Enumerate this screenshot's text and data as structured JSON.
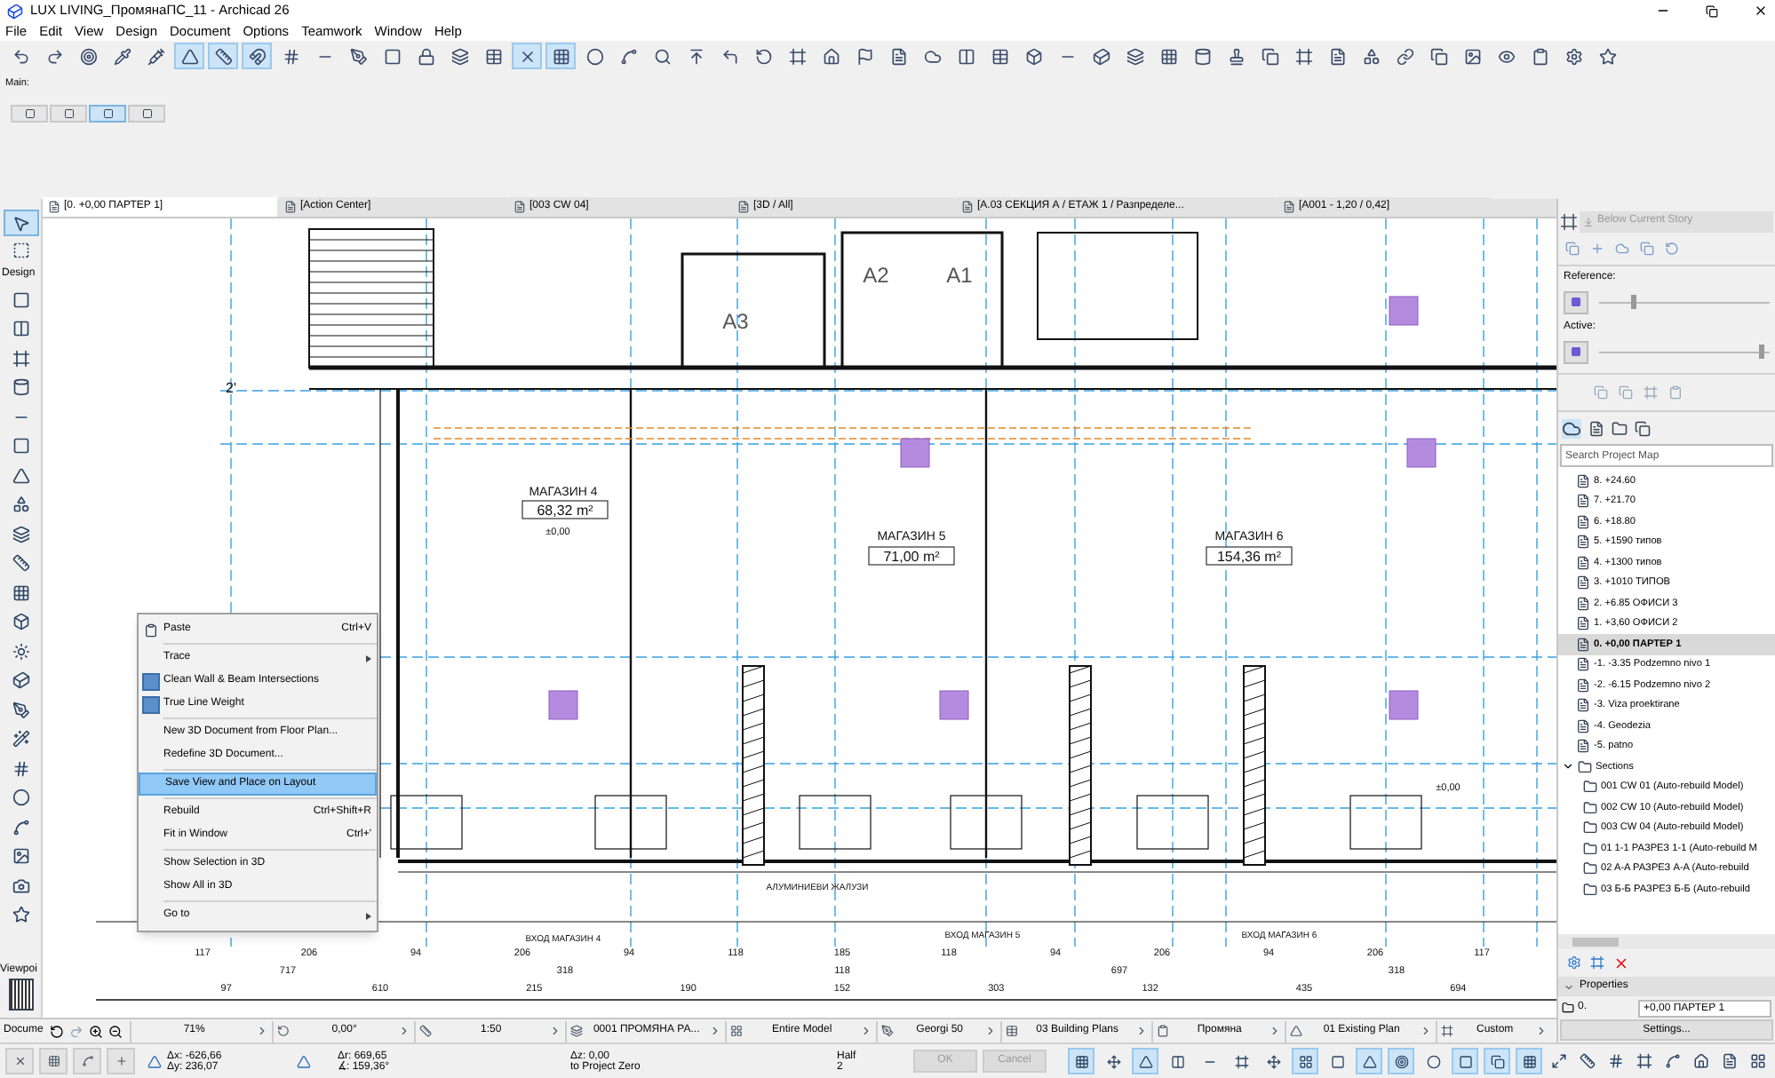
{
  "window": {
    "title": "LUX LIVING_ПромянаПС_11 - Archicad 26"
  },
  "menu": [
    "File",
    "Edit",
    "View",
    "Design",
    "Document",
    "Options",
    "Teamwork",
    "Window",
    "Help"
  ],
  "toolbar": {
    "buttons": [
      {
        "on": false
      },
      {
        "on": false
      },
      {
        "on": false
      },
      {
        "on": false
      },
      {
        "on": false
      },
      {
        "on": true
      },
      {
        "on": true
      },
      {
        "on": true
      },
      {
        "on": false
      },
      {
        "on": false
      },
      {
        "on": false
      },
      {
        "on": false
      },
      {
        "on": false
      },
      {
        "on": false
      },
      {
        "on": false
      },
      {
        "on": true
      },
      {
        "on": true
      },
      {
        "on": false
      },
      {
        "on": false
      },
      {
        "on": false
      },
      {
        "on": false
      },
      {
        "on": false
      },
      {
        "on": false
      },
      {
        "on": false
      },
      {
        "on": false
      },
      {
        "on": false
      },
      {
        "on": false
      },
      {
        "on": false
      },
      {
        "on": false
      },
      {
        "on": false
      },
      {
        "on": false
      },
      {
        "on": false
      },
      {
        "on": false
      },
      {
        "on": false
      },
      {
        "on": false
      },
      {
        "on": false
      },
      {
        "on": false
      },
      {
        "on": false
      },
      {
        "on": false
      },
      {
        "on": false
      },
      {
        "on": false
      },
      {
        "on": false
      },
      {
        "on": false
      },
      {
        "on": false
      },
      {
        "on": false
      },
      {
        "on": false
      },
      {
        "on": false
      },
      {
        "on": false
      }
    ]
  },
  "main_palette": {
    "label": "Main:",
    "buttons": [
      {
        "on": false
      },
      {
        "on": false
      },
      {
        "on": true
      },
      {
        "on": false
      }
    ]
  },
  "tabs": [
    {
      "label": "[0. +0,00 ПАРТЕР 1]",
      "selected": true
    },
    {
      "label": "[Action Center]",
      "selected": false
    },
    {
      "label": "[003 CW 04]",
      "selected": false
    },
    {
      "label": "[3D / All]",
      "selected": false
    },
    {
      "label": "[A.03 СЕКЦИЯ А / ЕТАЖ 1 / Разпределе...",
      "selected": false
    },
    {
      "label": "[A001 - 1,20 / 0,42]",
      "selected": false
    }
  ],
  "toolbox": {
    "title": "Design",
    "bottom_label": "Viewpoi",
    "tools": [
      {
        "selected": true
      },
      {
        "selected": false
      },
      {
        "selected": false
      },
      {
        "selected": false
      },
      {
        "selected": false
      },
      {
        "selected": false
      },
      {
        "selected": false
      },
      {
        "selected": false
      },
      {
        "selected": false
      },
      {
        "selected": false
      },
      {
        "selected": false
      },
      {
        "selected": false
      },
      {
        "selected": false
      },
      {
        "selected": false
      },
      {
        "selected": false
      },
      {
        "selected": false
      },
      {
        "selected": false
      },
      {
        "selected": false
      },
      {
        "selected": false
      },
      {
        "selected": false
      },
      {
        "selected": false
      },
      {
        "selected": false
      },
      {
        "selected": false
      },
      {
        "selected": false
      }
    ]
  },
  "drawing": {
    "labels": [
      {
        "text": "2'",
        "kind": "grid"
      },
      {
        "text": "A3",
        "kind": "tag"
      },
      {
        "text": "A2",
        "kind": "tag"
      },
      {
        "text": "A1",
        "kind": "tag"
      },
      {
        "text": "МАГАЗИН 4",
        "kind": "room"
      },
      {
        "text": "68,32 m²",
        "kind": "area"
      },
      {
        "text": "±0,00",
        "kind": "level"
      },
      {
        "text": "МАГАЗИН 5",
        "kind": "room"
      },
      {
        "text": "71,00 m²",
        "kind": "area"
      },
      {
        "text": "МАГАЗИН 6",
        "kind": "room"
      },
      {
        "text": "154,36 m²",
        "kind": "area"
      },
      {
        "text": "±0,00",
        "kind": "level"
      },
      {
        "text": "АЛУМИНИЕВИ ЖАЛУЗИ",
        "kind": "note"
      },
      {
        "text": "ВХОД МАГАЗИН 4",
        "kind": "note"
      },
      {
        "text": "ВХОД МАГАЗИН 5",
        "kind": "note"
      },
      {
        "text": "ВХОД МАГАЗИН 6",
        "kind": "note"
      }
    ],
    "dimension_rows": [
      [
        "117",
        "206",
        "94",
        "206",
        "94",
        "118",
        "185",
        "118",
        "94",
        "206",
        "94",
        "206",
        "117"
      ],
      [
        "717",
        "318",
        "118",
        "697",
        "318"
      ],
      [
        "97",
        "610",
        "215",
        "190",
        "152",
        "303",
        "132",
        "435",
        "694"
      ]
    ]
  },
  "context_menu": {
    "items": [
      {
        "kind": "item",
        "label": "Paste",
        "shortcut": "Ctrl+V",
        "submenu": false,
        "selected": false
      },
      {
        "kind": "separator"
      },
      {
        "kind": "item",
        "label": "Trace",
        "submenu": true,
        "selected": false
      },
      {
        "kind": "toggle",
        "label": "Clean Wall & Beam Intersections",
        "checked": true,
        "selected": false
      },
      {
        "kind": "toggle",
        "label": "True Line Weight",
        "checked": true,
        "selected": false
      },
      {
        "kind": "separator"
      },
      {
        "kind": "item",
        "label": "New 3D Document from Floor Plan...",
        "submenu": false,
        "selected": false
      },
      {
        "kind": "item",
        "label": "Redefine 3D Document...",
        "submenu": false,
        "selected": false
      },
      {
        "kind": "separator"
      },
      {
        "kind": "item",
        "label": "Save View and Place on Layout",
        "submenu": false,
        "selected": true
      },
      {
        "kind": "separator"
      },
      {
        "kind": "item",
        "label": "Rebuild",
        "shortcut": "Ctrl+Shift+R",
        "submenu": false,
        "selected": false
      },
      {
        "kind": "item",
        "label": "Fit in Window",
        "shortcut": "Ctrl+'",
        "submenu": false,
        "selected": false
      },
      {
        "kind": "separator"
      },
      {
        "kind": "item",
        "label": "Show Selection in 3D",
        "submenu": false,
        "selected": false
      },
      {
        "kind": "item",
        "label": "Show All in 3D",
        "submenu": false,
        "selected": false
      },
      {
        "kind": "separator"
      },
      {
        "kind": "item",
        "label": "Go to",
        "submenu": true,
        "selected": false
      }
    ]
  },
  "navigator": {
    "below_story_button": {
      "label": "Below Current Story",
      "disabled": true
    },
    "reference": {
      "label": "Reference:",
      "level": 0.2
    },
    "active": {
      "label": "Active:",
      "level": 0.95
    },
    "search": {
      "placeholder": "Search Project Map"
    },
    "tree": [
      {
        "label": "8. +24.60",
        "kind": "story",
        "selected": false
      },
      {
        "label": "7. +21.70",
        "kind": "story",
        "selected": false
      },
      {
        "label": "6. +18.80",
        "kind": "story",
        "selected": false
      },
      {
        "label": "5. +1590 типов",
        "kind": "story",
        "selected": false
      },
      {
        "label": "4. +1300 типов",
        "kind": "story",
        "selected": false
      },
      {
        "label": "3. +1010 ТИПОВ",
        "kind": "story",
        "selected": false
      },
      {
        "label": "2. +6.85 ОФИСИ 3",
        "kind": "story",
        "selected": false
      },
      {
        "label": "1. +3,60 ОФИСИ 2",
        "kind": "story",
        "selected": false
      },
      {
        "label": "0. +0,00 ПАРТЕР 1",
        "kind": "story",
        "selected": true
      },
      {
        "label": "-1. -3.35 Podzemno nivo 1",
        "kind": "story",
        "selected": false
      },
      {
        "label": "-2. -6.15 Podzemno nivo 2",
        "kind": "story",
        "selected": false
      },
      {
        "label": "-3. Viza proektirane",
        "kind": "story",
        "selected": false
      },
      {
        "label": "-4. Geodezia",
        "kind": "story",
        "selected": false
      },
      {
        "label": "-5. patno",
        "kind": "story",
        "selected": false
      },
      {
        "label": "Sections",
        "kind": "folder",
        "selected": false,
        "expanded": true,
        "children": [
          {
            "label": "001 CW 01 (Auto-rebuild Model)",
            "kind": "section",
            "selected": false
          },
          {
            "label": "002 CW 10 (Auto-rebuild Model)",
            "kind": "section",
            "selected": false
          },
          {
            "label": "003 CW 04 (Auto-rebuild Model)",
            "kind": "section",
            "selected": false
          },
          {
            "label": "01 1-1 РАЗРЕЗ 1-1 (Auto-rebuild M",
            "kind": "section",
            "selected": false
          },
          {
            "label": "02 A-A РАЗРЕЗ A-A (Auto-rebuild",
            "kind": "section",
            "selected": false
          },
          {
            "label": "03 Б-Б РАЗРЕЗ Б-Б (Auto-rebuild",
            "kind": "section",
            "selected": false
          }
        ]
      }
    ],
    "properties": {
      "title": "Properties",
      "id_label": "0.",
      "name_value": "+0,00 ПАРТЕР 1",
      "settings_button": "Settings..."
    }
  },
  "status_bar": {
    "label": "Docume",
    "items": [
      "71%",
      "0,00°",
      "1:50",
      "0001 ПРОМЯНА РА...",
      "Entire Model",
      "Georgi 50",
      "03 Building Plans",
      "Промяна",
      "01 Existing Plan",
      "Custom"
    ]
  },
  "info_box": {
    "dx": "Δx: -626,66",
    "dy": "Δy: 236,07",
    "dr": "Δr: 669,65",
    "angle": "∡: 159,36°",
    "dz": "Δz: 0,00",
    "reference": "to Project Zero",
    "pen_label": "Half",
    "pen_value": "2",
    "ok_button": {
      "label": "OK",
      "disabled": true
    },
    "cancel_button": {
      "label": "Cancel",
      "disabled": true
    },
    "buttons": [
      {
        "on": true
      },
      {
        "on": false
      },
      {
        "on": true
      },
      {
        "on": false
      },
      {
        "on": false
      },
      {
        "on": false
      },
      {
        "on": false
      },
      {
        "on": true
      },
      {
        "on": false
      },
      {
        "on": true
      },
      {
        "on": true
      },
      {
        "on": false
      },
      {
        "on": true
      },
      {
        "on": true
      },
      {
        "on": true
      }
    ]
  }
}
